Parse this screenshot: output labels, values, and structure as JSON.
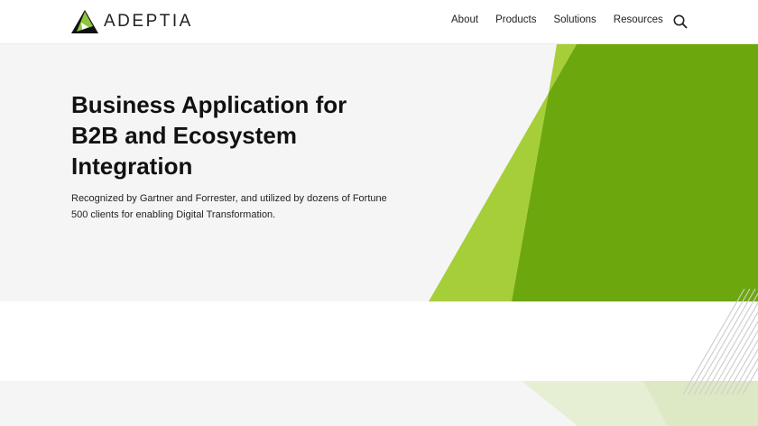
{
  "header": {
    "logo_text": "ADEPTIA",
    "nav": [
      "About",
      "Products",
      "Solutions",
      "Resources"
    ],
    "search_icon": "search-icon"
  },
  "hero": {
    "title": "Business Application for B2B and Ecosystem Integration",
    "description": "Recognized by Gartner and Forrester, and utilized by dozens of Fortune 500 clients for enabling Digital Transformation."
  },
  "colors": {
    "dark_green": "#6ca70e",
    "light_green": "#a6ce39",
    "pale_green": "#e3edcc"
  }
}
